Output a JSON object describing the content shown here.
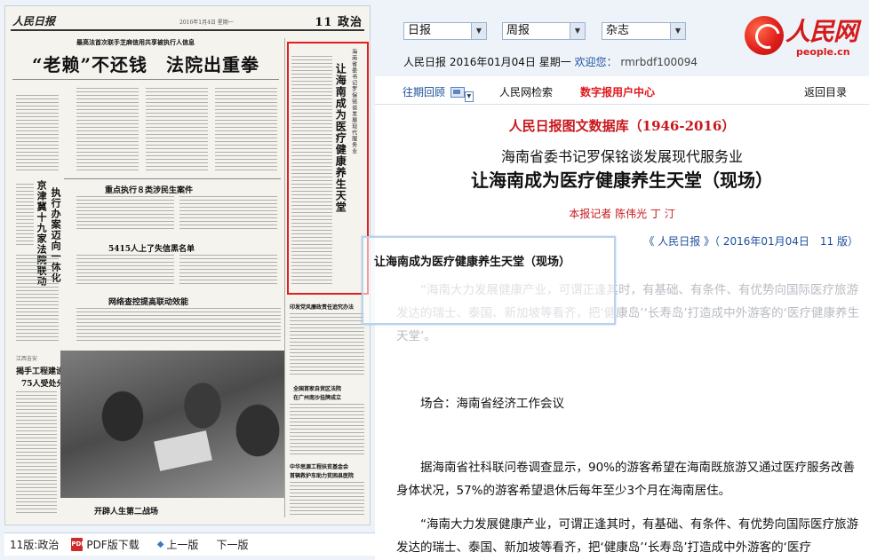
{
  "paper": {
    "logo": "人民日报",
    "date_line": "2016年1月4日 星期一",
    "section": "11 政治",
    "top_kicker": "最高法首次联手芝麻信用共享被执行人信息",
    "main_headline": "“老赖”不还钱　法院出重拳",
    "vertical_headline_left": "京津冀十九家法院联动",
    "vertical_headline_left2": "执行办案迈向一体化",
    "story1": "重点执行８类涉民生案件",
    "story2": "5415人上了失信黑名单",
    "story3": "网络查控提高联动效能",
    "story4_kicker": "江西吉安",
    "story4": "揭手工程建设",
    "story4b": "75人受处分",
    "right_kicker": "海南省委书记罗保铭谈发展现代服务业",
    "right_vertical": "让海南成为医疗健康养生天堂",
    "right_mid": "印发党风廉政责任追究办法",
    "right_low1": "全国首家自贸区法院",
    "right_low2": "在广州南沙挂牌成立",
    "right_low3": "中华思源工程扶贫基金会",
    "right_low4": "首辆救护车助力贫困县医院",
    "photo_caption": "开辟人生第二战场"
  },
  "pagebar": {
    "page_label": "11版:政治",
    "pdf_label": "PDF版下载",
    "prev_label": "上一版",
    "next_label": "下一版"
  },
  "selectors": {
    "ribao": "日报",
    "zhoubao": "周报",
    "zazhi": "杂志"
  },
  "info": {
    "date_text": "人民日报 2016年01月04日 星期一",
    "welcome_label": "欢迎您：",
    "user": "rmrbdf100094"
  },
  "brand": {
    "name_cn": "人民网",
    "name_en": "people.cn"
  },
  "nav": {
    "history": "往期回顾",
    "search": "人民网检索",
    "digital_user": "数字报用户中心",
    "back": "返回目录"
  },
  "article": {
    "db_title": "人民日报图文数据库（1946-2016）",
    "subtitle": "海南省委书记罗保铭谈发展现代服务业",
    "headline": "让海南成为医疗健康养生天堂（现场）",
    "byline": "本报记者 陈伟光 丁 汀",
    "source": "《 人民日报 》（ 2016年01月04日　11 版）",
    "para1": "“海南大力发展健康产业，可谓正逢其时，有基础、有条件、有优势向国际医疗旅游发达的瑞士、泰国、新加坡等看齐，把‘健康岛’‘长寿岛’打造成中外游客的‘医疗健康养生天堂’。",
    "para2": "场合：海南省经济工作会议",
    "para3": "据海南省社科联问卷调查显示，90%的游客希望在海南既旅游又通过医疗服务改善身体状况，57%的游客希望退休后每年至少3个月在海南居住。",
    "para4": "“海南大力发展健康产业，可谓正逢其时，有基础、有条件、有优势向国际医疗旅游发达的瑞士、泰国、新加坡等看齐，把‘健康岛’‘长寿岛’打造成中外游客的‘医疗"
  },
  "tooltip": {
    "text": "让海南成为医疗健康养生天堂（现场）"
  }
}
